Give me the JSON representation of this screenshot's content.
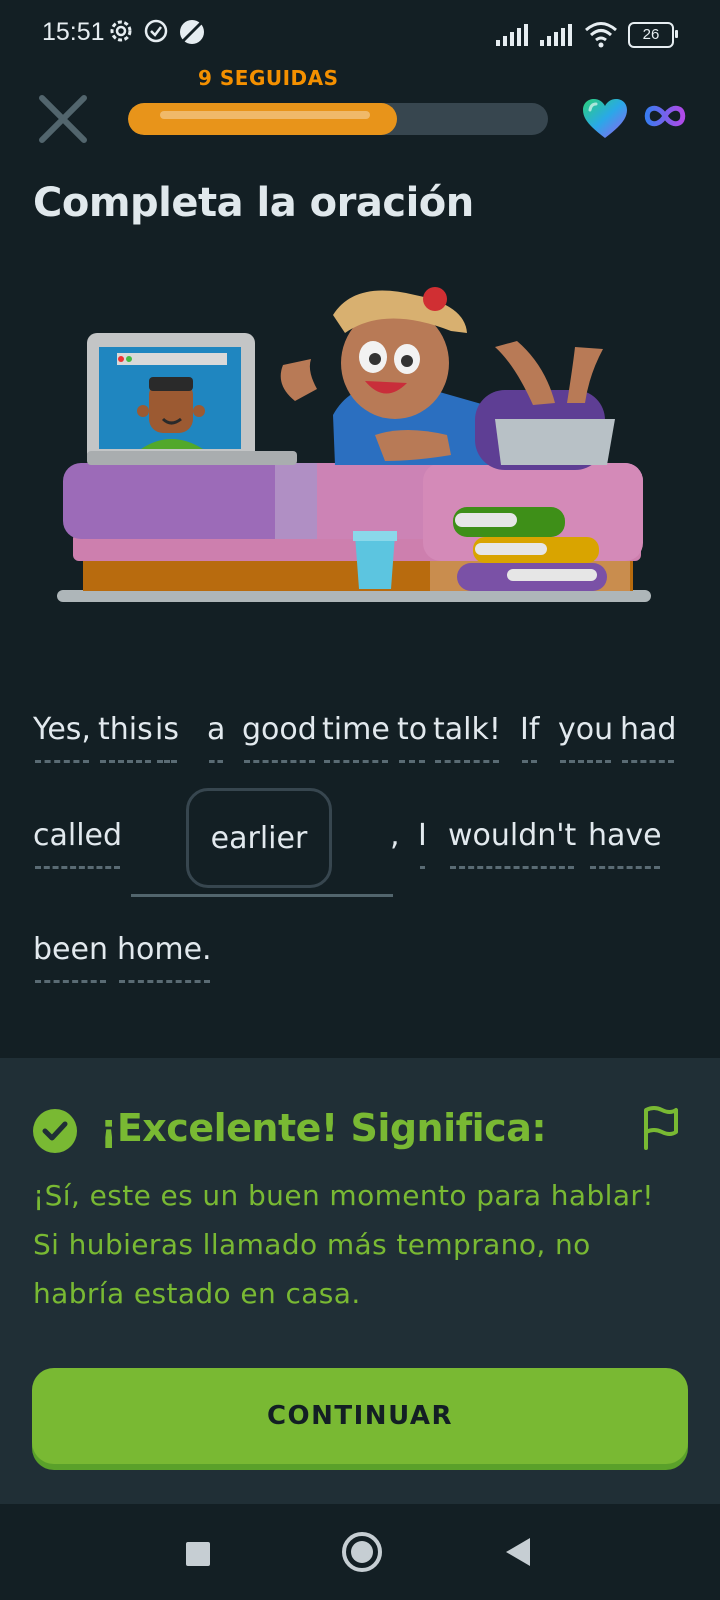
{
  "status_bar": {
    "time": "15:51",
    "battery": "26",
    "icons": [
      "settings-gear-icon",
      "check-circle-icon",
      "no-sync-icon",
      "signal-icon",
      "signal-icon",
      "wifi-icon",
      "battery-icon"
    ]
  },
  "header": {
    "close_icon": "close-icon",
    "streak_label": "9 SEGUIDAS",
    "progress": 0.64,
    "hearts_icon": "heart-icon",
    "hearts_value_icon": "infinity-icon"
  },
  "exercise": {
    "title": "Completa la oración",
    "sentence": {
      "w1": "Yes,",
      "w2": "this",
      "w3": "is",
      "w4": "a",
      "w5": "good",
      "w6": "time",
      "w7": "to",
      "w8": "talk!",
      "w9": "If",
      "w10": "you",
      "w11": "had",
      "w12": "called",
      "comma": ",",
      "w13": "I",
      "w14": "wouldn't",
      "w15": "have",
      "w16": "been",
      "w17": "home."
    },
    "answer": "earlier"
  },
  "feedback": {
    "title": "¡Excelente! Significa:",
    "translation": "¡Sí, este es un buen momento para hablar! Si hubieras llamado más temprano, no habría estado en casa.",
    "continue_label": "CONTINUAR",
    "check_icon": "check-circle-icon",
    "report_icon": "flag-icon"
  },
  "colors": {
    "background": "#131F24",
    "panel": "#202F36",
    "success_green": "#79B933",
    "streak_orange": "#F49000"
  }
}
